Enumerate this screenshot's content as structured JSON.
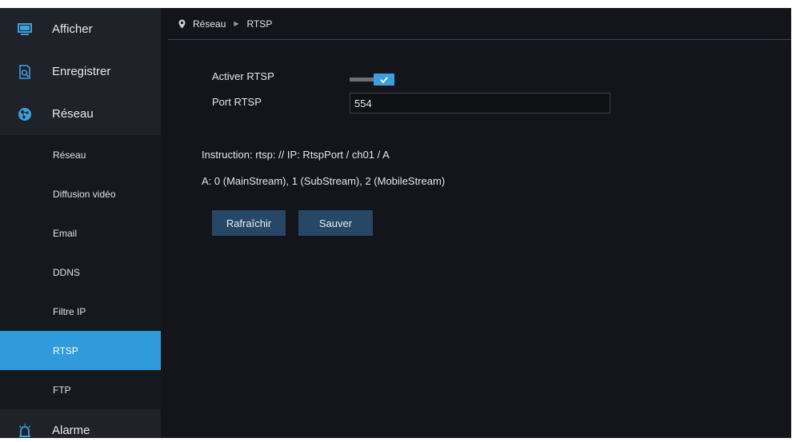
{
  "sidebar": {
    "top_items": [
      {
        "label": "Afficher",
        "icon": "monitor-icon"
      },
      {
        "label": "Enregistrer",
        "icon": "search-file-icon"
      },
      {
        "label": "Réseau",
        "icon": "network-globe-icon"
      }
    ],
    "sub_items": [
      {
        "label": "Réseau"
      },
      {
        "label": "Diffusion vidéo"
      },
      {
        "label": "Email"
      },
      {
        "label": "DDNS"
      },
      {
        "label": "Filtre IP"
      },
      {
        "label": "RTSP",
        "active": true
      },
      {
        "label": "FTP"
      }
    ],
    "bottom_item": {
      "label": "Alarme",
      "icon": "alarm-icon"
    }
  },
  "breadcrumb": {
    "section": "Réseau",
    "page": "RTSP"
  },
  "form": {
    "enable_label": "Activer RTSP",
    "enable_checked": true,
    "port_label": "Port RTSP",
    "port_value": "554",
    "instruction": "Instruction: rtsp: // IP: RtspPort / ch01 / A",
    "streams_note": "A: 0 (MainStream), 1 (SubStream), 2 (MobileStream)"
  },
  "buttons": {
    "refresh": "Rafraîchir",
    "save": "Sauver"
  },
  "colors": {
    "accent": "#2f9bdc",
    "button": "#274766",
    "sidebar": "#1f2228",
    "background": "#13151a"
  }
}
